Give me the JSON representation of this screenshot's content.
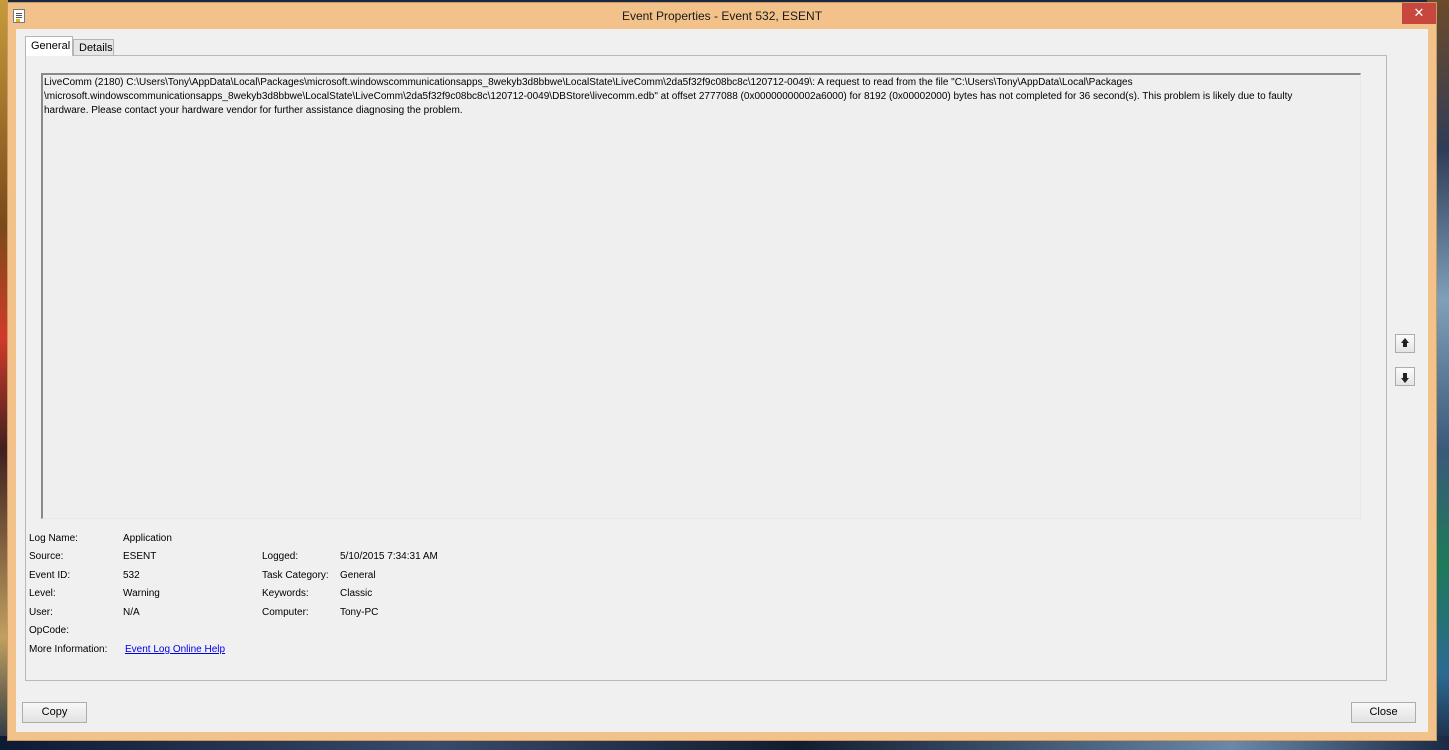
{
  "window": {
    "title": "Event Properties - Event 532, ESENT",
    "close_glyph": "✕"
  },
  "tabs": [
    {
      "label": "General",
      "active": true
    },
    {
      "label": "Details",
      "active": false
    }
  ],
  "description": "LiveComm (2180) C:\\Users\\Tony\\AppData\\Local\\Packages\\microsoft.windowscommunicationsapps_8wekyb3d8bbwe\\LocalState\\LiveComm\\2da5f32f9c08bc8c\\120712-0049\\: A request to read from the file \"C:\\Users\\Tony\\AppData\\Local\\Packages\n\\microsoft.windowscommunicationsapps_8wekyb3d8bbwe\\LocalState\\LiveComm\\2da5f32f9c08bc8c\\120712-0049\\DBStore\\livecomm.edb\" at offset 2777088 (0x00000000002a6000) for 8192 (0x00002000) bytes has not completed for 36 second(s). This problem is likely due to faulty\nhardware. Please contact your hardware vendor for further assistance diagnosing the problem.",
  "fields": {
    "log_name": {
      "label": "Log Name:",
      "value": "Application"
    },
    "source": {
      "label": "Source:",
      "value": "ESENT"
    },
    "event_id": {
      "label": "Event ID:",
      "value": "532"
    },
    "level": {
      "label": "Level:",
      "value": "Warning"
    },
    "user": {
      "label": "User:",
      "value": "N/A"
    },
    "opcode": {
      "label": "OpCode:",
      "value": ""
    },
    "more_info": {
      "label": "More Information:",
      "value": "Event Log Online Help"
    },
    "logged": {
      "label": "Logged:",
      "value": "5/10/2015 7:34:31 AM"
    },
    "task_category": {
      "label": "Task Category:",
      "value": "General"
    },
    "keywords": {
      "label": "Keywords:",
      "value": "Classic"
    },
    "computer": {
      "label": "Computer:",
      "value": "Tony-PC"
    }
  },
  "buttons": {
    "copy": "Copy",
    "close": "Close"
  },
  "colors": {
    "title_bar": "#f2c28a",
    "close_button": "#c7463e",
    "link": "#0000ee"
  }
}
